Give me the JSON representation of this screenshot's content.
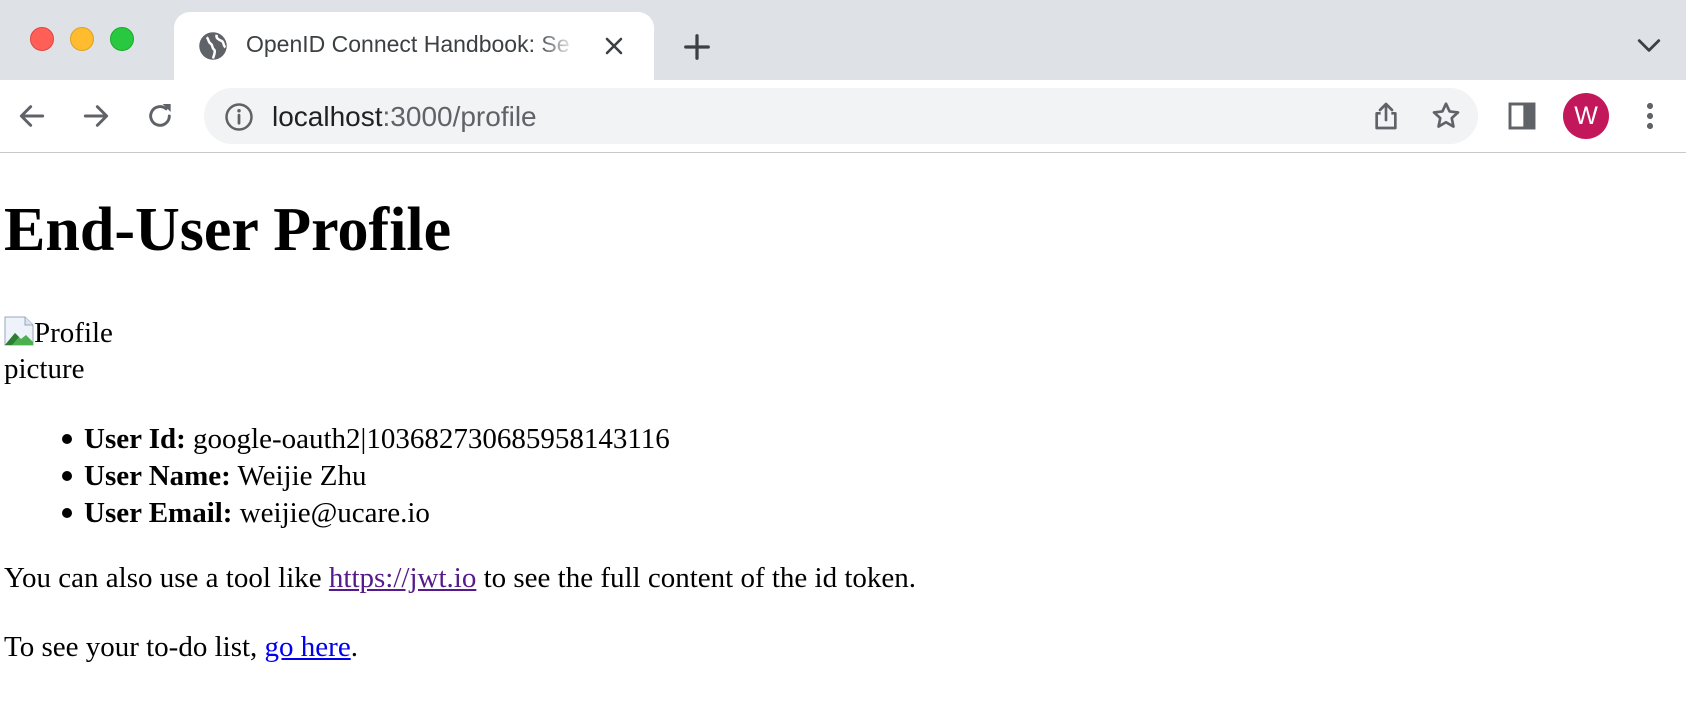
{
  "browser": {
    "tab": {
      "title": "OpenID Connect Handbook: Se",
      "favicon": "globe-icon",
      "close": "close-icon"
    },
    "new_tab": "plus-icon",
    "tab_list": "chevron-down-icon",
    "nav": {
      "back": "arrow-left-icon",
      "forward": "arrow-right-icon",
      "reload": "reload-icon"
    },
    "omnibox": {
      "site_info": "info-icon",
      "host": "localhost",
      "path": ":3000/profile",
      "share": "share-icon",
      "bookmark": "star-icon"
    },
    "side_panel": "side-panel-icon",
    "profile": {
      "initial": "W",
      "color": "#c2185b"
    },
    "menu": "kebab-menu-icon"
  },
  "page": {
    "title": "End-User Profile",
    "image_alt": "Profile picture",
    "fields": [
      {
        "label": "User Id:",
        "value": " google-oauth2|103682730685958143116"
      },
      {
        "label": "User Name:",
        "value": " Weijie Zhu"
      },
      {
        "label": "User Email:",
        "value": " weijie@ucare.io"
      }
    ],
    "jwt_paragraph": {
      "before": "You can also use a tool like ",
      "link": "https://jwt.io",
      "after": " to see the full content of the id token."
    },
    "todo_paragraph": {
      "before": "To see your to-do list, ",
      "link": "go here",
      "after": "."
    },
    "colors": {
      "link": "#0000ee",
      "visited_link": "#551a8b"
    }
  }
}
